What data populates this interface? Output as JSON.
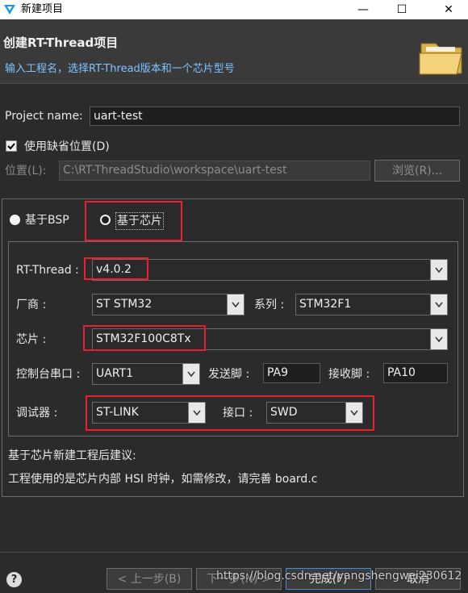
{
  "window": {
    "title": "新建项目",
    "minimize": "—",
    "maximize": "☐",
    "close": "✕"
  },
  "banner": {
    "title": "创建RT-Thread项目",
    "subtitle": "输入工程名，选择RT-Thread版本和一个芯片型号"
  },
  "project": {
    "name_label": "Project name:",
    "name_value": "uart-test",
    "default_location_label": "使用缺省位置(D)",
    "default_location_checked": true,
    "location_label": "位置(L):",
    "location_value": "C:\\RT-ThreadStudio\\workspace\\uart-test",
    "browse_label": "浏览(R)..."
  },
  "mode": {
    "bsp_label": "基于BSP",
    "chip_label": "基于芯片",
    "selected": "chip"
  },
  "chip": {
    "rtt_label": "RT-Thread :",
    "rtt_value": "v4.0.2",
    "vendor_label": "厂商 :",
    "vendor_value": "ST STM32",
    "series_label": "系列 :",
    "series_value": "STM32F1",
    "chip_label": "芯片 :",
    "chip_value": "STM32F100C8Tx",
    "console_label": "控制台串口 :",
    "console_value": "UART1",
    "tx_label": "发送脚 :",
    "tx_value": "PA9",
    "rx_label": "接收脚 :",
    "rx_value": "PA10",
    "debugger_label": "调试器 :",
    "debugger_value": "ST-LINK",
    "interface_label": "接口 :",
    "interface_value": "SWD"
  },
  "advice": {
    "title": "基于芯片新建工程后建议:",
    "text": "工程使用的是芯片内部 HSI 时钟，如需修改，请完善 board.c"
  },
  "footer": {
    "help": "?",
    "back": "< 上一步(B)",
    "next": "下一步(N) >",
    "finish": "完成(F)",
    "cancel": "取消"
  },
  "watermark": "https://blog.csdn.net/yangshengwei230612",
  "colors": {
    "accent": "#e8212e",
    "link": "#7fc3ff"
  }
}
